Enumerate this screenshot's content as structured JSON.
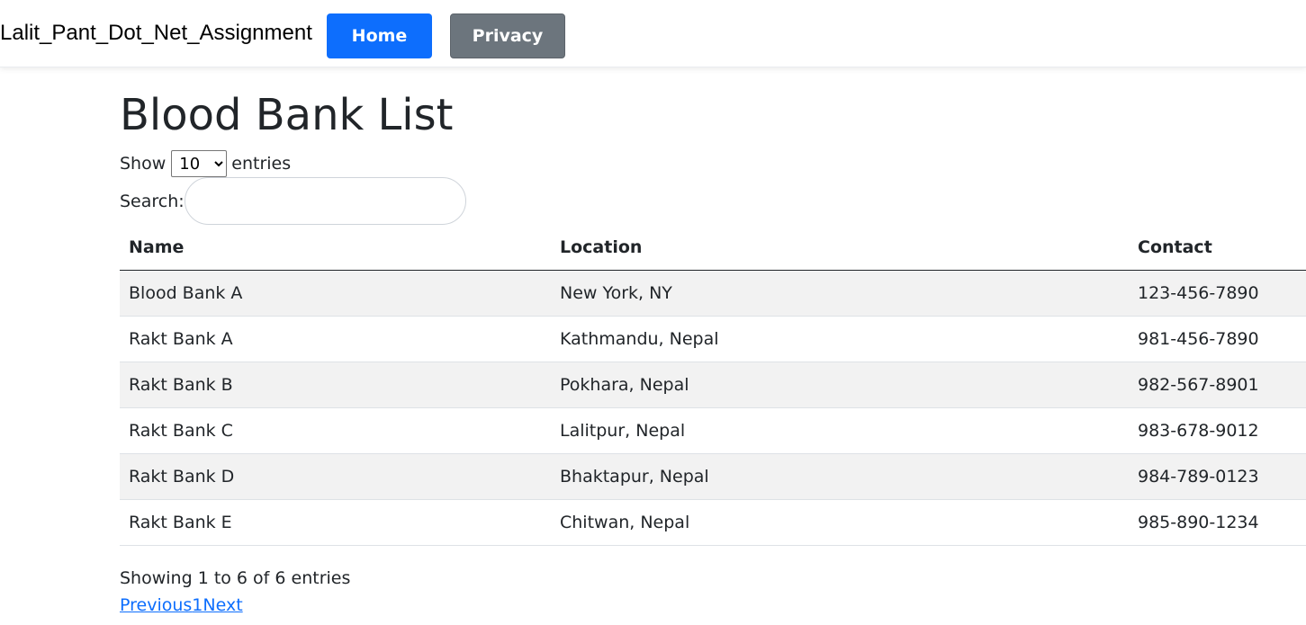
{
  "navbar": {
    "brand": "Lalit_Pant_Dot_Net_Assignment",
    "items": [
      {
        "label": "Home",
        "color": "#0d6efd"
      },
      {
        "label": "Privacy",
        "color": "#6c757d"
      }
    ]
  },
  "main": {
    "title": "Blood Bank List",
    "length": {
      "prefix": "Show",
      "value": "10",
      "suffix": "entries",
      "options": [
        "10"
      ]
    },
    "search": {
      "label": "Search:",
      "value": "",
      "placeholder": ""
    },
    "table": {
      "columns": [
        "Name",
        "Location",
        "Contact"
      ],
      "rows": [
        [
          "Blood Bank A",
          "New York, NY",
          "123-456-7890"
        ],
        [
          "Rakt Bank A",
          "Kathmandu, Nepal",
          "981-456-7890"
        ],
        [
          "Rakt Bank B",
          "Pokhara, Nepal",
          "982-567-8901"
        ],
        [
          "Rakt Bank C",
          "Lalitpur, Nepal",
          "983-678-9012"
        ],
        [
          "Rakt Bank D",
          "Bhaktapur, Nepal",
          "984-789-0123"
        ],
        [
          "Rakt Bank E",
          "Chitwan, Nepal",
          "985-890-1234"
        ]
      ]
    },
    "info": "Showing 1 to 6 of 6 entries",
    "pagination": {
      "previous": "Previous",
      "page": "1",
      "next": "Next"
    }
  },
  "colors": {
    "link": "#0d6efd",
    "striped_row": "#f2f2f2"
  }
}
